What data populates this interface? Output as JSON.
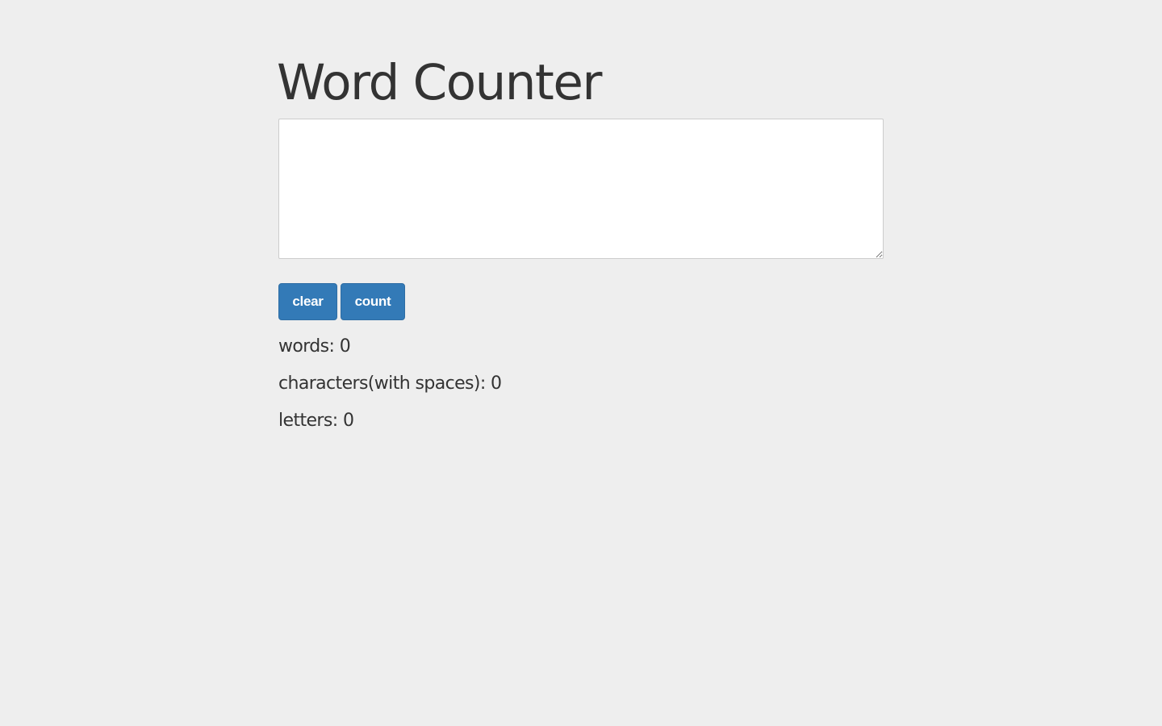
{
  "app": {
    "title": "Word Counter"
  },
  "editor": {
    "value": "",
    "placeholder": ""
  },
  "buttons": {
    "clear_label": "clear",
    "count_label": "count"
  },
  "stats": {
    "words": "words: 0",
    "characters": "characters(with spaces): 0",
    "letters": "letters: 0"
  },
  "colors": {
    "background": "#eeeeee",
    "button": "#337ab7",
    "button_text": "#ffffff",
    "text": "#333333"
  }
}
